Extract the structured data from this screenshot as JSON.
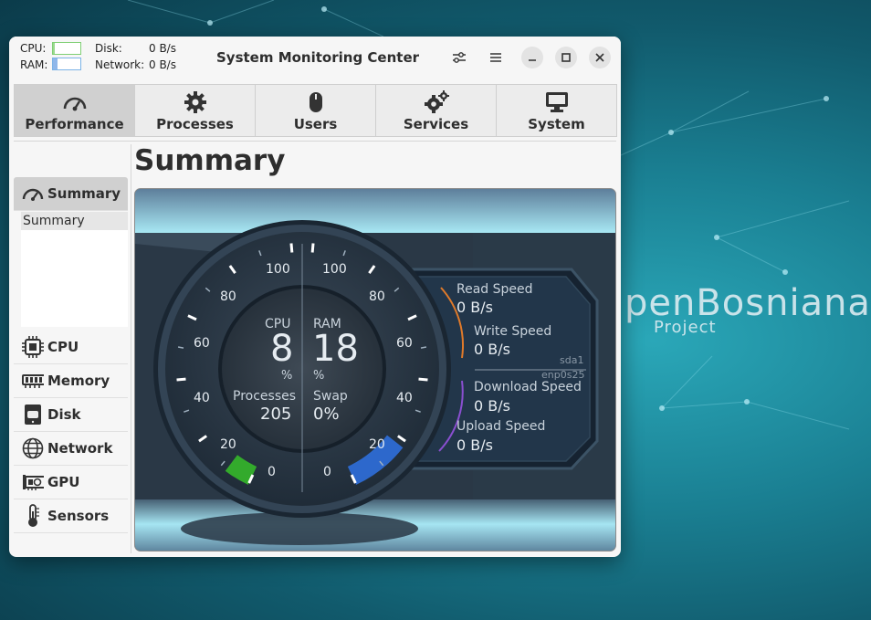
{
  "window": {
    "title": "System Monitoring Center",
    "mini": {
      "cpu_label": "CPU:",
      "ram_label": "RAM:",
      "cpu_fraction": 0.08,
      "ram_fraction": 0.18,
      "disk_label": "Disk:",
      "disk_value": "0 B/s",
      "network_label": "Network:",
      "network_value": "0 B/s"
    }
  },
  "tabs": [
    {
      "label": "Performance",
      "icon": "speedometer-icon",
      "active": true
    },
    {
      "label": "Processes",
      "icon": "gear-icon"
    },
    {
      "label": "Users",
      "icon": "mouse-icon"
    },
    {
      "label": "Services",
      "icon": "gears-icon"
    },
    {
      "label": "System",
      "icon": "monitor-icon"
    }
  ],
  "sidebar": {
    "items": [
      {
        "label": "Summary",
        "icon": "speedometer-icon",
        "active": true
      },
      {
        "label": "CPU",
        "icon": "cpu-chip-icon"
      },
      {
        "label": "Memory",
        "icon": "memory-icon"
      },
      {
        "label": "Disk",
        "icon": "disk-icon"
      },
      {
        "label": "Network",
        "icon": "globe-icon"
      },
      {
        "label": "GPU",
        "icon": "gpu-card-icon"
      },
      {
        "label": "Sensors",
        "icon": "thermometer-icon"
      }
    ],
    "sublist": [
      "Summary"
    ]
  },
  "main": {
    "heading": "Summary",
    "gauge": {
      "ticks_left": [
        "100",
        "80",
        "60",
        "40",
        "20",
        "0"
      ],
      "ticks_right": [
        "100",
        "80",
        "60",
        "40",
        "20",
        "0"
      ],
      "cpu_label": "CPU",
      "cpu_value": "8",
      "cpu_unit": "%",
      "ram_label": "RAM",
      "ram_value": "18",
      "ram_unit": "%",
      "processes_label": "Processes",
      "processes_value": "205",
      "swap_label": "Swap",
      "swap_value": "0%",
      "cpu_percent": 8,
      "ram_percent": 18
    },
    "io": {
      "read_label": "Read Speed",
      "read_value": "0 B/s",
      "write_label": "Write Speed",
      "write_value": "0 B/s",
      "disk_name": "sda1",
      "net_name": "enp0s25",
      "download_label": "Download Speed",
      "download_value": "0 B/s",
      "upload_label": "Upload Speed",
      "upload_value": "0 B/s"
    }
  },
  "desktop": {
    "brand_text": "penBosniana",
    "brand_sub": "Project"
  },
  "colors": {
    "accent_cpu": "#35b82a",
    "accent_ram": "#2f6fdc",
    "read_arc": "#e07a2a",
    "upload_arc": "#8a4fd0"
  }
}
